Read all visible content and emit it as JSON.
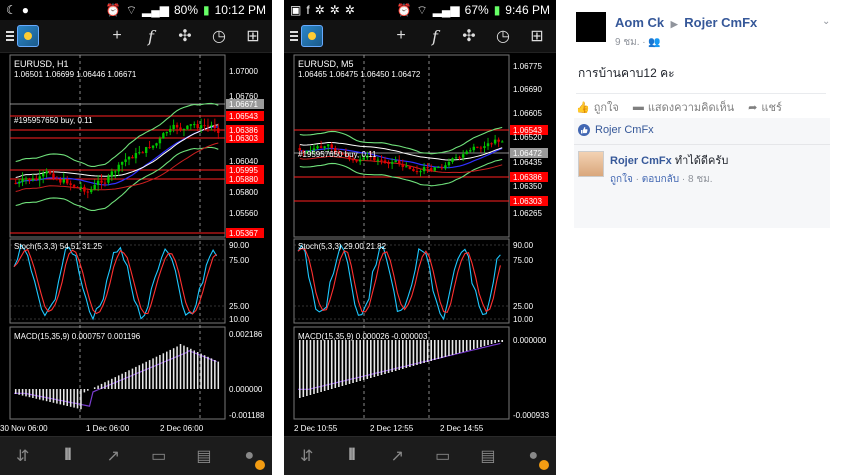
{
  "phone1": {
    "status": {
      "battery": "80%",
      "time": "10:12 PM"
    },
    "symbol_title": "EURUSD, H1",
    "ohlc": "1.06501 1.06699 1.06446 1.06671",
    "order_label": "#195957650 buy, 0.11",
    "price_levels": [
      "1.07000",
      "1.06760",
      "1.06671",
      "1.06543",
      "1.06386",
      "1.06303",
      "1.06040",
      "1.05995",
      "1.05880",
      "1.05800",
      "1.05560",
      "1.05367"
    ],
    "stoch_label": "Stoch(5,3,3) 54.51 31.25",
    "stoch_levels": [
      "90.00",
      "75.00",
      "25.00",
      "10.00"
    ],
    "macd_label": "MACD(15,35,9) 0.000757 0.001196",
    "macd_levels": [
      "0.002186",
      "0.000000",
      "-0.001188"
    ],
    "time_labels": [
      "30 Nov 06:00",
      "1 Dec 06:00",
      "2 Dec 06:00"
    ]
  },
  "phone2": {
    "status": {
      "battery": "67%",
      "time": "9:46 PM"
    },
    "symbol_title": "EURUSD, M5",
    "ohlc": "1.06465 1.06475 1.06450 1.06472",
    "order_label": "#195957650 buy, 0.11",
    "price_levels": [
      "1.06775",
      "1.06690",
      "1.06605",
      "1.06543",
      "1.06520",
      "1.06472",
      "1.06435",
      "1.06386",
      "1.06350",
      "1.06303",
      "1.06265"
    ],
    "stoch_label": "Stoch(5,3,3) 29.00 21.82",
    "stoch_levels": [
      "90.00",
      "75.00",
      "25.00",
      "10.00"
    ],
    "macd_label": "MACD(15,35,9) 0.000026 -0.000003",
    "macd_levels": [
      "0.000000",
      "-0.000933"
    ],
    "time_labels": [
      "2 Dec 10:55",
      "2 Dec 12:55",
      "2 Dec 14:55"
    ]
  },
  "toolbar_icons": [
    "menu-icon",
    "app-logo",
    "crosshair-icon",
    "function-icon",
    "objects-icon",
    "clock-icon",
    "add-template-icon"
  ],
  "bottom_nav": [
    {
      "name": "nav-quotes-icon",
      "active": false
    },
    {
      "name": "nav-chart-icon",
      "active": true
    },
    {
      "name": "nav-trade-icon",
      "active": false
    },
    {
      "name": "nav-history-icon",
      "active": false
    },
    {
      "name": "nav-news-icon",
      "active": false
    },
    {
      "name": "nav-messages-icon",
      "active": false
    }
  ],
  "facebook": {
    "author": "Aom Ck",
    "recipient": "Rojer CmFx",
    "time": "9 ชม.",
    "post_text": "การบ้านคาบ12 คะ",
    "actions": {
      "like": "ถูกใจ",
      "comment": "แสดงความคิดเห็น",
      "share": "แชร์"
    },
    "liked_by": "Rojer CmFx",
    "comment": {
      "name": "Rojer CmFx",
      "text": "ทำได้ดีครับ",
      "like": "ถูกใจ",
      "reply": "ตอบกลับ",
      "time": "8 ชม."
    }
  },
  "colors": {
    "bull": "#00c800",
    "bear": "#e00000",
    "bb": "#2e8b57",
    "ma": "#3030ff",
    "stoch_main": "#1ec8ff",
    "stoch_signal": "#ff3030",
    "macd_signal": "#7a3dd0",
    "fb_blue": "#365899",
    "price_tag_red": "#ff0000"
  }
}
